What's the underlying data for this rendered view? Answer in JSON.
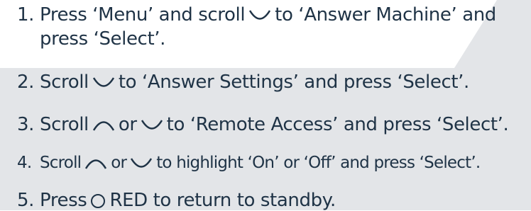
{
  "steps": [
    {
      "number": "1.",
      "part1": "Press ‘Menu’ and scroll",
      "scroll_icon": "scroll-down-icon",
      "part2": "to ‘Answer Machine’ and",
      "line2": "press ‘Select’."
    },
    {
      "number": "2.",
      "part1": "Scroll",
      "scroll_icon": "scroll-down-icon",
      "part2": "to ‘Answer Settings’ and press  ‘Select’."
    },
    {
      "number": "3.",
      "part1": "Scroll",
      "icon_up": "scroll-up-icon",
      "or_text": "or",
      "icon_down": "scroll-down-icon",
      "part2": "to ‘Remote Access’ and press ‘Select’."
    },
    {
      "number": "4.",
      "part1": "Scroll",
      "icon_up": "scroll-up-icon",
      "or_text": "or",
      "icon_down": "scroll-down-icon",
      "part2": "to highlight ‘On’ or ‘Off’ and press ‘Select’."
    },
    {
      "number": "5.",
      "part1": "Press",
      "button_icon": "red-button-icon",
      "part2": "RED to return to standby."
    }
  ],
  "colors": {
    "text": "#1f3346",
    "background_light": "#ffffff",
    "background_grey": "#e3e5e8"
  }
}
